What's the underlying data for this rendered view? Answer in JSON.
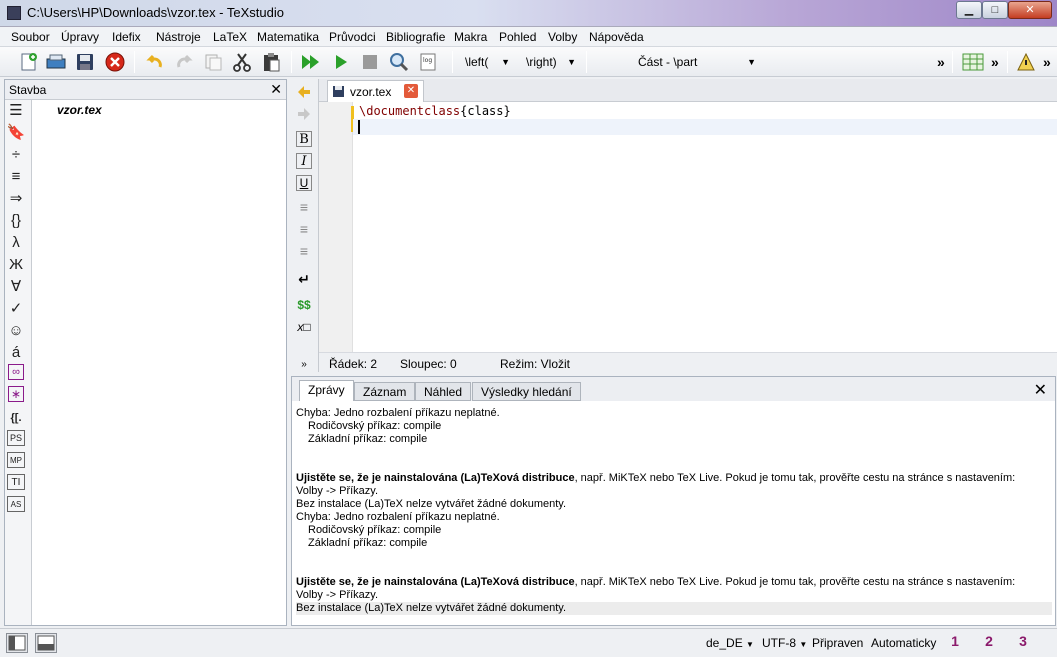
{
  "window": {
    "title": "C:\\Users\\HP\\Downloads\\vzor.tex - TeXstudio",
    "controls": {
      "minimize": "▁",
      "maximize": "□",
      "close": "✕"
    }
  },
  "menu": [
    "Soubor",
    "Úpravy",
    "Idefix",
    "Nástroje",
    "LaTeX",
    "Matematika",
    "Průvodci",
    "Bibliografie",
    "Makra",
    "Pohled",
    "Volby",
    "Nápověda"
  ],
  "toolbar": {
    "left_combo": "\\left(",
    "right_combo": "\\right)",
    "part_combo": "Část - \\part",
    "more1": "»",
    "more2": "»",
    "more3": "»",
    "log_label": "log"
  },
  "structure_panel": {
    "title": "Stavba",
    "close": "✕",
    "file": "vzor.tex",
    "icons": [
      "☰",
      "🔖",
      "÷",
      "≡",
      "⇒",
      "{}",
      "λ",
      "Ж",
      "∀",
      "✓",
      "☺",
      "á",
      "∞",
      "∗",
      "{[.",
      "PS",
      "MP",
      "TI",
      "AS"
    ]
  },
  "format_strip": {
    "icons": [
      "B",
      "I",
      "U",
      "≡",
      "≡",
      "≡",
      "↵",
      "$$",
      "x□"
    ]
  },
  "editor": {
    "tab_name": "vzor.tex",
    "tab_close": "✕",
    "line1_cmd": "\\documentclass",
    "line1_arg": "{class}",
    "status": {
      "line": "Řádek: 2",
      "col": "Sloupec: 0",
      "mode": "Režim: Vložit"
    }
  },
  "messages": {
    "tabs": [
      "Zprávy",
      "Záznam",
      "Náhled",
      "Výsledky hledání"
    ],
    "active_tab": 0,
    "close": "✕",
    "err": "Chyba: Jedno rozbalení příkazu neplatné.",
    "parent": "Rodičovský příkaz: compile",
    "base": "Základní příkaz: compile",
    "bold": "Ujistěte se, že je nainstalována (La)TeXová distribuce",
    "rest": ", např. MiKTeX nebo TeX Live. Pokud je tomu tak, prověřte cestu na stránce s nastavením:",
    "volby": "Volby -> Příkazy.",
    "noinst": "Bez instalace (La)TeX nelze vytvářet žádné dokumenty."
  },
  "statusbar": {
    "lang": "de_DE",
    "encoding": "UTF-8",
    "ready": "Připraven",
    "auto": "Automaticky",
    "marks": [
      "1",
      "2",
      "3"
    ]
  }
}
